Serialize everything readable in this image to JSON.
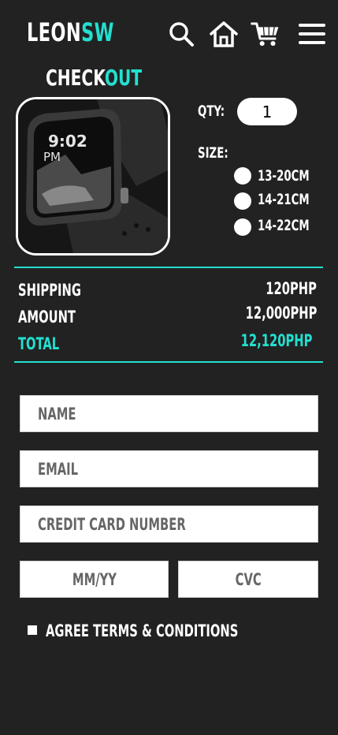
{
  "header": {
    "logo_main": "LEON",
    "logo_accent": "SW"
  },
  "page": {
    "title_main": "CHECK",
    "title_accent": "OUT"
  },
  "product": {
    "watch_time": "9:02",
    "watch_ampm": "PM"
  },
  "options": {
    "qty_label": "QTY:",
    "qty_value": "1",
    "size_label": "SIZE:",
    "sizes": [
      "13-20CM",
      "14-21CM",
      "14-22CM"
    ]
  },
  "summary": {
    "shipping_label": "SHIPPING",
    "shipping_value": "120PHP",
    "amount_label": "AMOUNT",
    "amount_value": "12,000PHP",
    "total_label": "TOTAL",
    "total_value": "12,120PHP"
  },
  "form": {
    "name_placeholder": "NAME",
    "email_placeholder": "EMAIL",
    "card_placeholder": "CREDIT CARD NUMBER",
    "expiry_placeholder": "MM/YY",
    "cvc_placeholder": "CVC",
    "terms_label": "AGREE TERMS & CONDITIONS"
  },
  "colors": {
    "background": "#222222",
    "accent": "#22e0d0",
    "text": "#ffffff"
  },
  "icons": [
    "search-icon",
    "home-icon",
    "cart-icon",
    "menu-icon"
  ]
}
